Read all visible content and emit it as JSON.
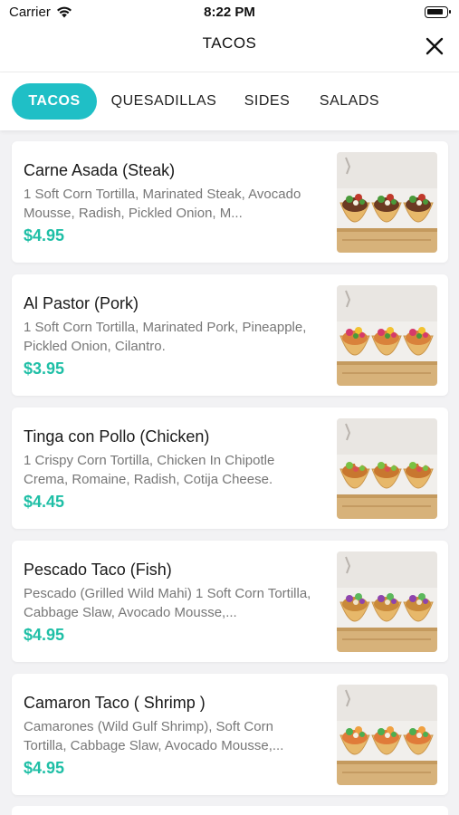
{
  "status": {
    "carrier": "Carrier",
    "time": "8:22 PM"
  },
  "nav": {
    "title": "TACOS"
  },
  "tabs": [
    {
      "label": "TACOS"
    },
    {
      "label": "QUESADILLAS"
    },
    {
      "label": "SIDES"
    },
    {
      "label": "SALADS"
    }
  ],
  "colors": {
    "accent": "#1fbfc6",
    "price": "#1fbfa6"
  },
  "items": [
    {
      "name": "Carne Asada (Steak)",
      "description": "1 Soft Corn Tortilla, Marinated Steak, Avocado Mousse, Radish, Pickled Onion, M...",
      "price": "$4.95",
      "filling": "steak"
    },
    {
      "name": "Al Pastor (Pork)",
      "description": "1 Soft Corn Tortilla, Marinated Pork, Pineapple, Pickled Onion, Cilantro.",
      "price": "$3.95",
      "filling": "pork"
    },
    {
      "name": "Tinga con Pollo (Chicken)",
      "description": "1 Crispy Corn Tortilla, Chicken In Chipotle Crema, Romaine, Radish, Cotija Cheese.",
      "price": "$4.45",
      "filling": "chicken"
    },
    {
      "name": "Pescado Taco (Fish)",
      "description": "Pescado (Grilled Wild Mahi) 1 Soft Corn Tortilla, Cabbage Slaw, Avocado Mousse,...",
      "price": "$4.95",
      "filling": "fish"
    },
    {
      "name": "Camaron Taco ( Shrimp )",
      "description": "Camarones (Wild Gulf Shrimp),  Soft Corn Tortilla, Cabbage Slaw, Avocado Mousse,...",
      "price": "$4.95",
      "filling": "shrimp"
    }
  ]
}
